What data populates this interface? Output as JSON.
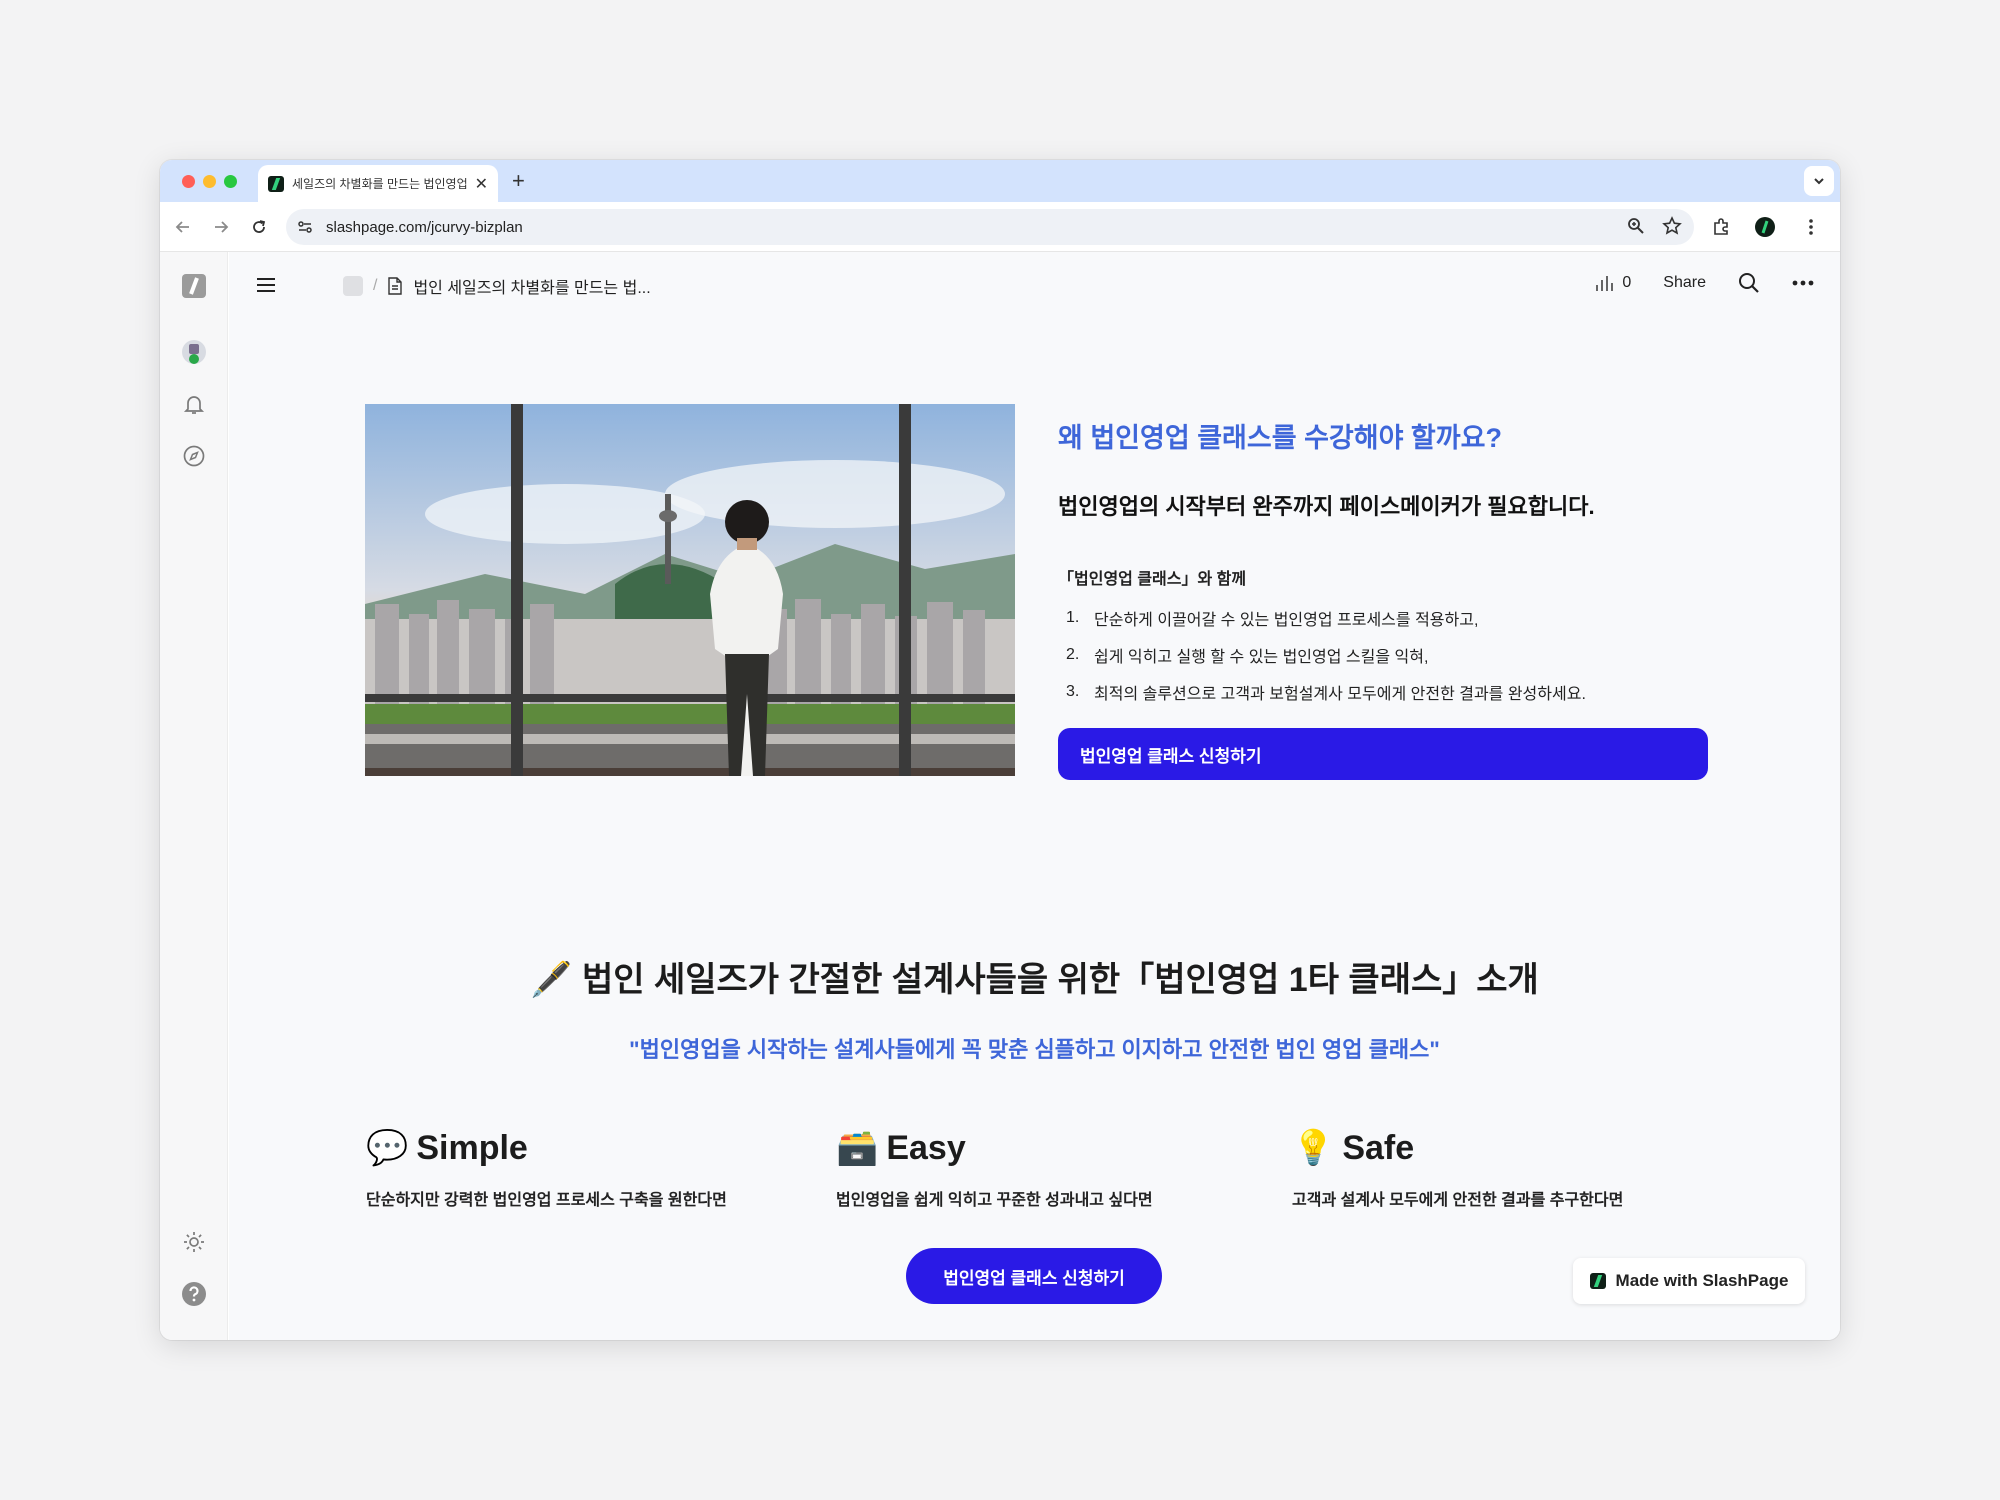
{
  "browser": {
    "tab_title": "세일즈의 차별화를 만드는 법인영업",
    "url": "slashpage.com/jcurvy-bizplan"
  },
  "page_header": {
    "breadcrumb_page": "법인 세일즈의 차별화를 만드는 법...",
    "view_count": "0",
    "share_label": "Share"
  },
  "hero": {
    "title": "왜 법인영업 클래스를 수강해야 할까요?",
    "subtitle": "법인영업의 시작부터 완주까지 페이스메이커가 필요합니다.",
    "intro": "「법인영업 클래스」와 함께",
    "steps": [
      {
        "num": "1.",
        "text": "단순하게 이끌어갈 수 있는 법인영업 프로세스를 적용하고,"
      },
      {
        "num": "2.",
        "text": "쉽게 익히고 실행 할 수 있는 법인영업 스킬을 익혀,"
      },
      {
        "num": "3.",
        "text": "최적의 솔루션으로 고객과 보험설계사 모두에게 안전한 결과를 완성하세요."
      }
    ],
    "cta_label": "법인영업 클래스 신청하기"
  },
  "intro_section": {
    "title": "🖋️ 법인 세일즈가 간절한 설계사들을 위한「법인영업 1타 클래스」소개",
    "quote": "\"법인영업을 시작하는 설계사들에게 꼭 맞춘 심플하고 이지하고 안전한 법인 영업 클래스\""
  },
  "features": [
    {
      "emoji": "💬",
      "title": "Simple",
      "desc": "단순하지만 강력한 법인영업 프로세스 구축을 원한다면"
    },
    {
      "emoji": "🗃️",
      "title": "Easy",
      "desc": "법인영업을 쉽게 익히고 꾸준한 성과내고 싶다면"
    },
    {
      "emoji": "💡",
      "title": "Safe",
      "desc": "고객과 설계사 모두에게 안전한 결과를 추구한다면"
    }
  ],
  "bottom_cta_label": "법인영업 클래스 신청하기",
  "made_with_label": "Made with SlashPage",
  "colors": {
    "brand_blue": "#2a1ae6",
    "accent_blue": "#3e66d9",
    "tab_bar": "#d3e3fd"
  }
}
